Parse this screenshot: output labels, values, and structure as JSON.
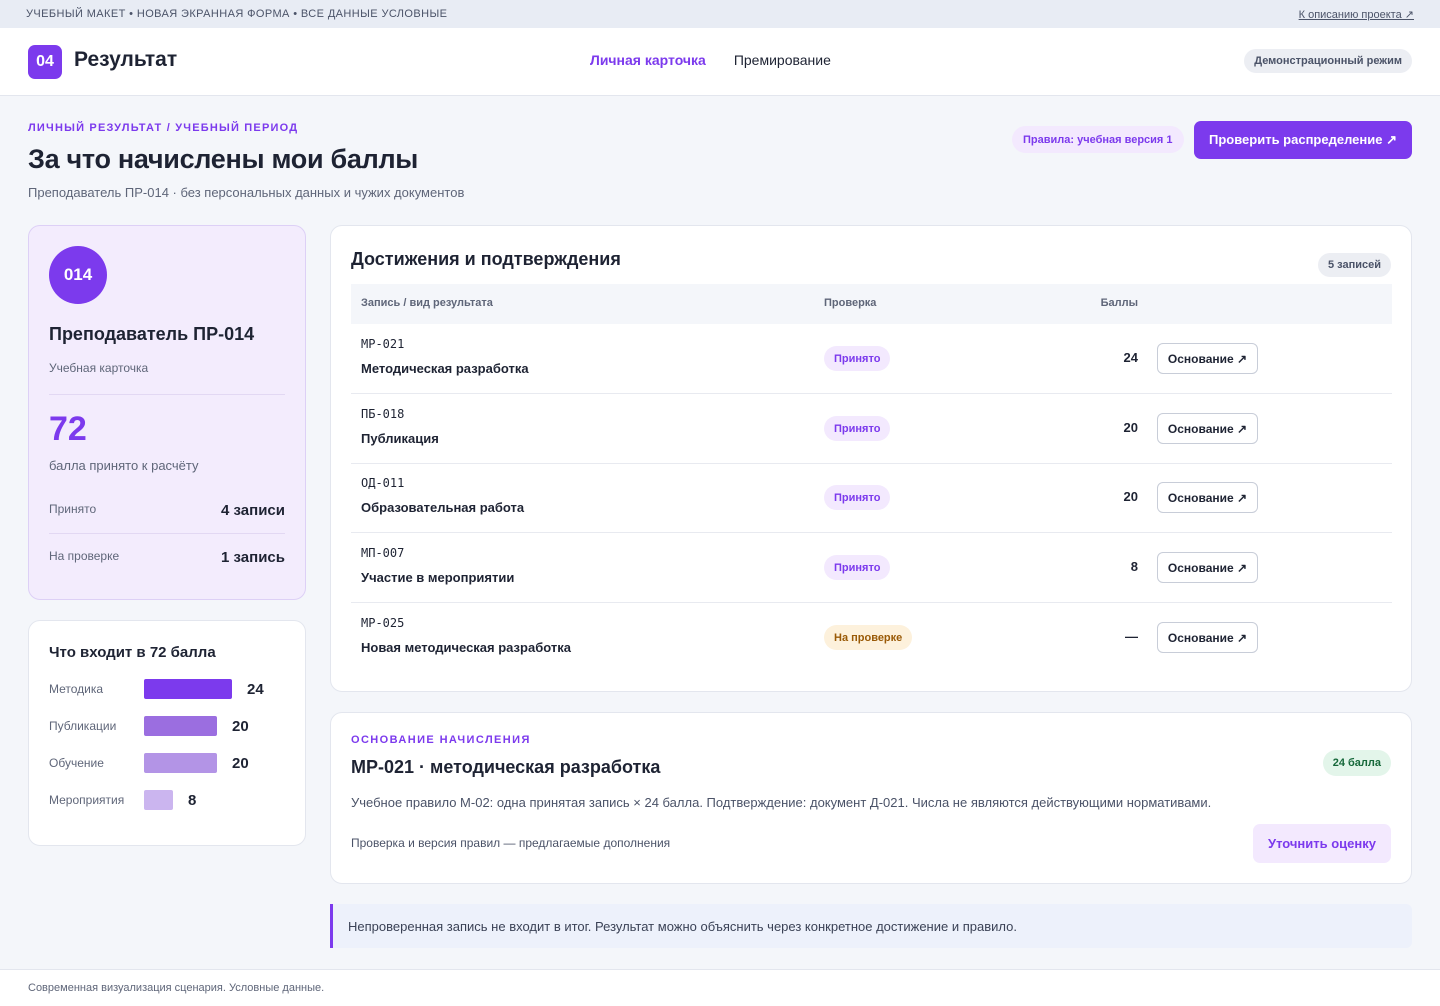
{
  "topbar": {
    "banner": "УЧЕБНЫЙ МАКЕТ • НОВАЯ ЭКРАННАЯ ФОРМА • ВСЕ ДАННЫЕ УСЛОВНЫЕ",
    "project_link": "К описанию проекта ↗"
  },
  "header": {
    "badge": "04",
    "title": "Результат",
    "nav": [
      {
        "label": "Личная карточка",
        "active": true
      },
      {
        "label": "Премирование",
        "active": false
      }
    ],
    "demo_mode": "Демонстрационный режим"
  },
  "page": {
    "eyebrow": "ЛИЧНЫЙ РЕЗУЛЬТАТ / УЧЕБНЫЙ ПЕРИОД",
    "title": "За что начислены мои баллы",
    "subtitle": "Преподаватель ПР-014 · без персональных данных и чужих документов",
    "rules_pill": "Правила: учебная версия 1",
    "check_button": "Проверить распределение ↗"
  },
  "profile": {
    "avatar": "014",
    "name": "Преподаватель ПР-014",
    "role": "Учебная карточка",
    "score": "72",
    "score_caption": "балла принято к расчёту",
    "stats": [
      {
        "label": "Принято",
        "value": "4 записи"
      },
      {
        "label": "На проверке",
        "value": "1 запись"
      }
    ]
  },
  "breakdown": {
    "title": "Что входит в 72 балла",
    "max": 24,
    "items": [
      {
        "label": "Методика",
        "value": 24,
        "color": "#7c3aed"
      },
      {
        "label": "Публикации",
        "value": 20,
        "color": "#9b6ee0"
      },
      {
        "label": "Обучение",
        "value": 20,
        "color": "#b394e6"
      },
      {
        "label": "Мероприятия",
        "value": 8,
        "color": "#cbb5ef"
      }
    ]
  },
  "achievements": {
    "title": "Достижения и подтверждения",
    "count": "5 записей",
    "columns": [
      "Запись / вид результата",
      "Проверка",
      "Баллы"
    ],
    "rows": [
      {
        "code": "МР-021",
        "name": "Методическая разработка",
        "status": "Принято",
        "state": "ok",
        "points": "24",
        "action": "Основание ↗"
      },
      {
        "code": "ПБ-018",
        "name": "Публикация",
        "status": "Принято",
        "state": "ok",
        "points": "20",
        "action": "Основание ↗"
      },
      {
        "code": "ОД-011",
        "name": "Образовательная работа",
        "status": "Принято",
        "state": "ok",
        "points": "20",
        "action": "Основание ↗"
      },
      {
        "code": "МП-007",
        "name": "Участие в мероприятии",
        "status": "Принято",
        "state": "ok",
        "points": "8",
        "action": "Основание ↗"
      },
      {
        "code": "МР-025",
        "name": "Новая методическая разработка",
        "status": "На проверке",
        "state": "wait",
        "points": "—",
        "action": "Основание ↗"
      }
    ]
  },
  "basis": {
    "eyebrow": "ОСНОВАНИЕ НАЧИСЛЕНИЯ",
    "title": "МР-021 · методическая разработка",
    "points_pill": "24 балла",
    "text": "Учебное правило М-02: одна принятая запись × 24 балла. Подтверждение: документ Д-021. Числа не являются действующими нормативами.",
    "note": "Проверка и версия правил — предлагаемые дополнения",
    "refine_button": "Уточнить оценку"
  },
  "notice": "Непроверенная запись не входит в итог. Результат можно объяснить через конкретное достижение и правило.",
  "footer": "Современная визуализация сценария. Условные данные."
}
